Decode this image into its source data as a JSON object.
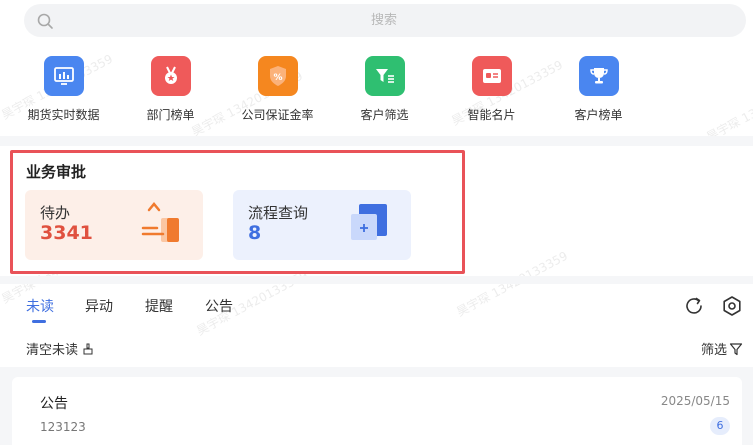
{
  "search": {
    "placeholder": "搜索"
  },
  "quick_actions": [
    {
      "label": "期货实时数据",
      "icon": "bar-chart-icon",
      "color": "#4a86f0"
    },
    {
      "label": "部门榜单",
      "icon": "medal-icon",
      "color": "#ef5a5a"
    },
    {
      "label": "公司保证金率",
      "icon": "percent-shield-icon",
      "color": "#f5871f"
    },
    {
      "label": "客户筛选",
      "icon": "filter-list-icon",
      "color": "#2fbf71"
    },
    {
      "label": "智能名片",
      "icon": "business-card-icon",
      "color": "#ef5a5a"
    },
    {
      "label": "客户榜单",
      "icon": "trophy-icon",
      "color": "#4a86f0"
    }
  ],
  "approval": {
    "title": "业务审批",
    "cards": [
      {
        "label": "待办",
        "count": "3341"
      },
      {
        "label": "流程查询",
        "count": "8"
      }
    ]
  },
  "tabs": [
    {
      "label": "未读",
      "active": true
    },
    {
      "label": "异动",
      "active": false
    },
    {
      "label": "提醒",
      "active": false
    },
    {
      "label": "公告",
      "active": false
    }
  ],
  "toolbar": {
    "clear_label": "清空未读",
    "filter_label": "筛选"
  },
  "notice": {
    "title": "公告",
    "date": "2025/05/15",
    "subtitle": "123123",
    "badge": "6"
  },
  "watermark": "昊宇琛 13420133359",
  "colors": {
    "accent": "#3f6fe0",
    "highlight_border": "#e95258",
    "todo_count": "#e0513f"
  }
}
